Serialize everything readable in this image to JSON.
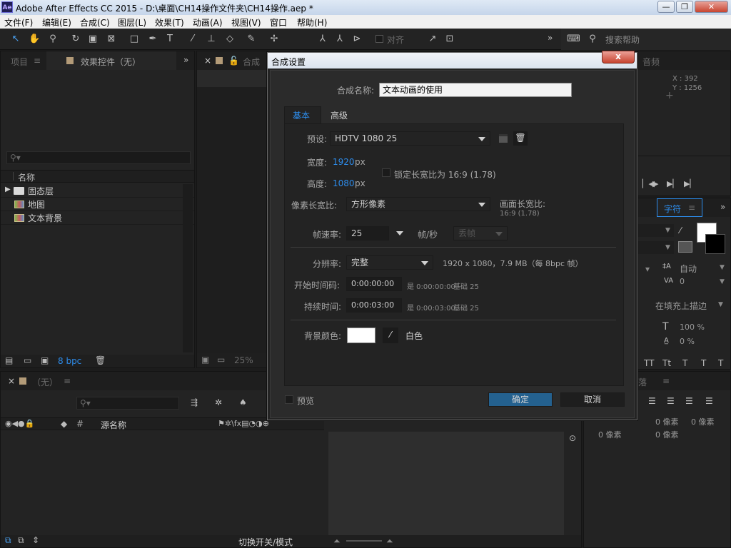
{
  "window": {
    "app_icon": "Ae",
    "title": "Adobe After Effects CC 2015 - D:\\桌面\\CH14操作文件夹\\CH14操作.aep *",
    "min": "—",
    "max": "❐",
    "close": "✕"
  },
  "menu": [
    "文件(F)",
    "编辑(E)",
    "合成(C)",
    "图层(L)",
    "效果(T)",
    "动画(A)",
    "视图(V)",
    "窗口",
    "帮助(H)"
  ],
  "toolbar": {
    "align_label": "对齐",
    "search_placeholder": "搜索帮助",
    "more": "»"
  },
  "project_panel": {
    "tab_project": "项目",
    "tab_effects": "效果控件（无）",
    "more": "»",
    "name_header": "名称",
    "items": [
      {
        "name": "固态层",
        "type": "folder"
      },
      {
        "name": "地图",
        "type": "comp"
      },
      {
        "name": "文本背景",
        "type": "comp"
      }
    ],
    "bpc": "8 bpc"
  },
  "comp_panel": {
    "tab": "合成",
    "zoom": "25%"
  },
  "info_panel": {
    "tab": "音频",
    "x": "X : 392",
    "y": "Y : 1256"
  },
  "char_panel": {
    "tab": "字符",
    "auto": "自动",
    "kerning": "0",
    "fill_mode": "在填充上描边",
    "scale_v": "100 %",
    "baseline": "0 %",
    "tt": [
      "TT",
      "Tt",
      "T",
      "T",
      "T"
    ]
  },
  "para_panel": {
    "tab": "落",
    "px1": "0 像素",
    "px2": "0 像素",
    "px3": "0 像素",
    "px4": "0 像素"
  },
  "timeline": {
    "tab": "（无）",
    "source_name": "源名称",
    "hash": "#",
    "toggle_label": "切换开关/模式"
  },
  "dialog": {
    "title": "合成设置",
    "close": "x",
    "comp_name_label": "合成名称:",
    "comp_name_value": "文本动画的使用",
    "tabs": [
      "基本",
      "高级"
    ],
    "preset_label": "预设:",
    "preset_value": "HDTV 1080 25",
    "width_label": "宽度:",
    "width_value": "1920",
    "height_label": "高度:",
    "height_value": "1080",
    "unit_px": "px",
    "lock_ratio_label": "锁定长宽比为 16:9 (1.78)",
    "par_label": "像素长宽比:",
    "par_value": "方形像素",
    "frame_ratio_label": "画面长宽比:",
    "frame_ratio_value": "16:9 (1.78)",
    "fps_label": "帧速率:",
    "fps_value": "25",
    "fps_unit": "帧/秒",
    "drop_frame": "丢帧",
    "res_label": "分辨率:",
    "res_value": "完整",
    "res_info": "1920 x 1080，7.9 MB（每 8bpc 帧）",
    "start_tc_label": "开始时间码:",
    "start_tc_value": "0:00:00:00",
    "start_tc_info": "是 0:00:00:00",
    "start_tc_base": "基础 25",
    "duration_label": "持续时间:",
    "duration_value": "0:00:03:00",
    "duration_info": "是 0:00:03:00",
    "duration_base": "基础 25",
    "bg_label": "背景颜色:",
    "bg_color_name": "白色",
    "bg_color": "#ffffff",
    "preview_label": "预览",
    "ok": "确定",
    "cancel": "取消"
  },
  "colors": {
    "accent": "#2d8ceb",
    "ok_button": "#24618f"
  }
}
